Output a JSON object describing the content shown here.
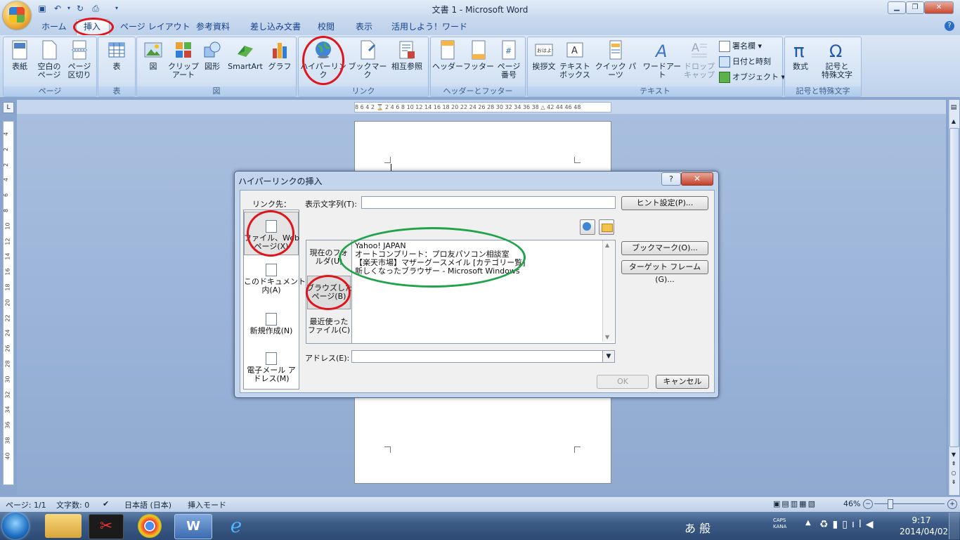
{
  "window": {
    "title": "文書 1 - Microsoft Word"
  },
  "tabs": [
    "ホーム",
    "挿入",
    "ページ レイアウト",
    "参考資料",
    "差し込み文書",
    "校閲",
    "表示",
    "活用しよう！ワード"
  ],
  "ribbon": {
    "groups": {
      "page": {
        "label": "ページ",
        "buttons": [
          "表紙",
          "空白の\nページ",
          "ページ\n区切り"
        ]
      },
      "table": {
        "label": "表",
        "buttons": [
          "表"
        ]
      },
      "illustrations": {
        "label": "図",
        "buttons": [
          "図",
          "クリップ\nアート",
          "図形",
          "SmartArt",
          "グラフ"
        ]
      },
      "links": {
        "label": "リンク",
        "buttons": [
          "ハイパーリンク",
          "ブックマーク",
          "相互参照"
        ]
      },
      "header_footer": {
        "label": "ヘッダーとフッター",
        "buttons": [
          "ヘッダー",
          "フッター",
          "ページ\n番号"
        ]
      },
      "text": {
        "label": "テキスト",
        "buttons": [
          "挨拶文",
          "テキスト\nボックス",
          "クイック パーツ",
          "ワードアート",
          "ドロップ\nキャップ"
        ],
        "small": [
          "署名欄",
          "日付と時刻",
          "オブジェクト"
        ]
      },
      "symbols": {
        "label": "記号と特殊文字",
        "buttons": [
          "数式",
          "記号と\n特殊文字"
        ]
      }
    }
  },
  "ruler": {
    "horizontal": "8 6 4 2 ⌛ 2 4 6 8 10 12 14 16 18 20 22 24 26 28 30 32 34 36 38 △ 42 44 46 48",
    "vertical": [
      "4",
      "2",
      "2",
      "4",
      "6",
      "8",
      "10",
      "12",
      "14",
      "16",
      "18",
      "20",
      "22",
      "24",
      "26",
      "28",
      "30",
      "32",
      "34",
      "36",
      "38",
      "40"
    ]
  },
  "dialog": {
    "title": "ハイパーリンクの挿入",
    "help": "?",
    "close": "✕",
    "link_to_label": "リンク先：",
    "link_to_items": [
      "ファイル、Web\nページ(X)",
      "このドキュメント\n内(A)",
      "新規作成(N)",
      "電子メール ア\nドレス(M)"
    ],
    "display_text_label": "表示文字列(T):",
    "display_text_value": "",
    "hint_button": "ヒント設定(P)...",
    "sub_items": [
      "現在のフォ\nルダ(U)",
      "ブラウズした\nページ(B)",
      "最近使った\nファイル(C)"
    ],
    "list_items": [
      "Yahoo! JAPAN",
      "オートコンプリート：プロ友パソコン相談室",
      "【楽天市場】マザーグースメイル [カテゴリー覧]",
      "新しくなったブラウザー - Microsoft Windows"
    ],
    "bookmark_button": "ブックマーク(O)...",
    "target_frame_button": "ターゲット フレーム(G)...",
    "address_label": "アドレス(E):",
    "address_value": "",
    "ok_button": "OK",
    "cancel_button": "キャンセル"
  },
  "status_bar": {
    "page": "ページ: 1/1",
    "word_count": "文字数: 0",
    "language": "日本語 (日本)",
    "mode": "挿入モード",
    "zoom": "46%"
  },
  "taskbar": {
    "ime": "あ 般",
    "caps": "CAPS",
    "kana": "KANA",
    "time": "9:17",
    "date": "2014/04/02"
  }
}
